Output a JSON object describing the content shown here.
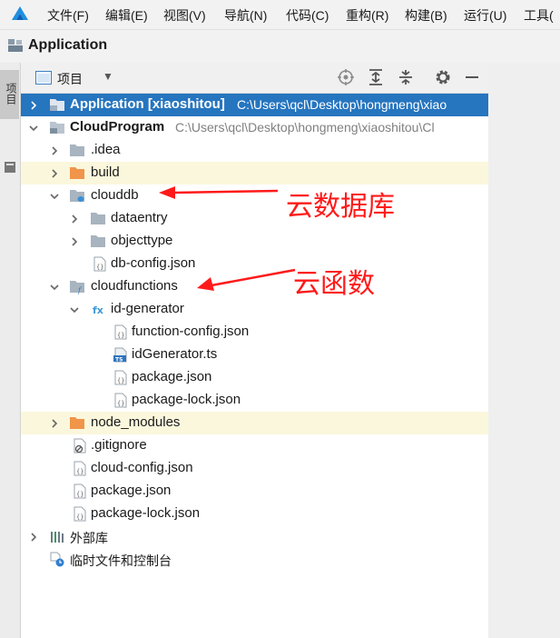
{
  "menu": {
    "items": [
      "文件(F)",
      "编辑(E)",
      "视图(V)",
      "导航(N)",
      "代码(C)",
      "重构(R)",
      "构建(B)",
      "运行(U)",
      "工具(",
      ""
    ]
  },
  "breadcrumb": {
    "title": "Application"
  },
  "left_strip": {
    "tab_label": "项目"
  },
  "toolbar": {
    "label": "项目"
  },
  "tree": {
    "application": {
      "label": "Application",
      "module": "[xiaoshitou]",
      "path": "C:\\Users\\qcl\\Desktop\\hongmeng\\xiao"
    },
    "cloudprogram": {
      "label": "CloudProgram",
      "path": "C:\\Users\\qcl\\Desktop\\hongmeng\\xiaoshitou\\Cl"
    },
    "idea": ".idea",
    "build": "build",
    "clouddb": "clouddb",
    "dataentry": "dataentry",
    "objecttype": "objecttype",
    "db_config": "db-config.json",
    "cloudfunctions": "cloudfunctions",
    "id_generator": "id-generator",
    "function_config": "function-config.json",
    "idgenerator_ts": "idGenerator.ts",
    "package_json_inner": "package.json",
    "package_lock_inner": "package-lock.json",
    "node_modules": "node_modules",
    "gitignore": ".gitignore",
    "cloud_config": "cloud-config.json",
    "package_json": "package.json",
    "package_lock": "package-lock.json",
    "external_libs": "外部库",
    "scratches": "临时文件和控制台"
  },
  "annotations": {
    "clouddb": "云数据库",
    "cloudfunctions": "云函数"
  },
  "colors": {
    "selection": "#2675bf",
    "highlight": "#fbf7dc",
    "annotation": "#ff1a1a",
    "folder_excluded": "#f0954a"
  }
}
